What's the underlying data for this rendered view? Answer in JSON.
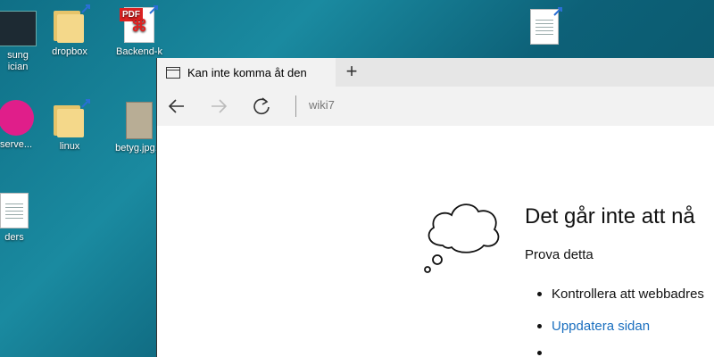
{
  "desktop": {
    "icons": [
      {
        "label": "sung\nician",
        "type": "app"
      },
      {
        "label": "dropbox",
        "type": "folder"
      },
      {
        "label": "Backend-k",
        "type": "pdf",
        "pdf_tag": "PDF"
      },
      {
        "label": "serve...",
        "type": "app"
      },
      {
        "label": "linux",
        "type": "folder"
      },
      {
        "label": "betyg.jpg...",
        "type": "image"
      },
      {
        "label": "ders",
        "type": "doc"
      },
      {
        "label": "",
        "type": "doc"
      }
    ]
  },
  "browser": {
    "tab_title": "Kan inte komma åt den",
    "new_tab_symbol": "+",
    "address": "wiki7"
  },
  "error_page": {
    "title": "Det går inte att nå",
    "try_this": "Prova detta",
    "suggestions": [
      {
        "text": "Kontrollera att webbadres",
        "link": false
      },
      {
        "text": "Uppdatera sidan",
        "link": true
      },
      {
        "text": "",
        "link": true
      }
    ]
  },
  "colors": {
    "link": "#1a6fbf",
    "desktop": "#0f6f86",
    "pdf_red": "#d22"
  }
}
